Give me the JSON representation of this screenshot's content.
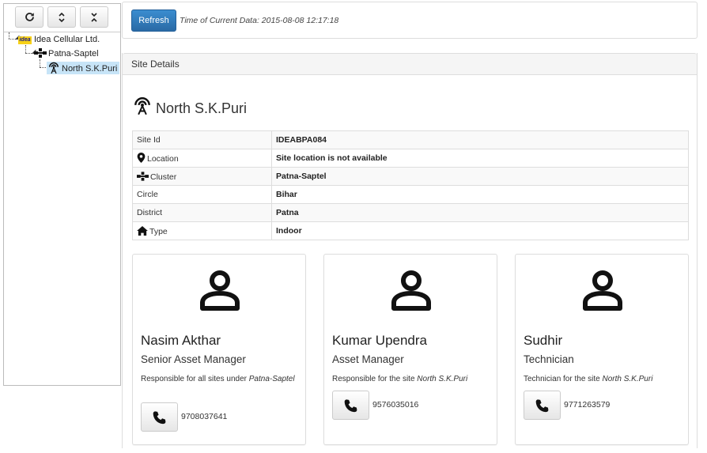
{
  "tree": {
    "toolbar": {
      "refresh_icon": "refresh-icon",
      "expand_icon": "expand-all-icon",
      "collapse_icon": "collapse-all-icon"
    },
    "nodes": [
      {
        "label": "Idea Cellular Ltd.",
        "icon": "idea-logo",
        "logo_text": "idea"
      },
      {
        "label": "Patna-Saptel",
        "icon": "cluster-icon"
      },
      {
        "label": "North S.K.Puri",
        "icon": "tower-icon",
        "selected": true
      }
    ]
  },
  "header": {
    "refresh_label": "Refresh",
    "data_time": "Time of Current Data: 2015-08-08 12:17:18"
  },
  "site": {
    "panel_title": "Site Details",
    "name": "North S.K.Puri",
    "details": [
      {
        "key": "Site Id",
        "value": "IDEABPA084",
        "icon": ""
      },
      {
        "key": "Location",
        "value": "Site location is not available",
        "icon": "map-marker-icon"
      },
      {
        "key": "Cluster",
        "value": "Patna-Saptel",
        "icon": "cluster-icon"
      },
      {
        "key": "Circle",
        "value": "Bihar",
        "icon": ""
      },
      {
        "key": "District",
        "value": "Patna",
        "icon": ""
      },
      {
        "key": "Type",
        "value": "Indoor",
        "icon": "home-icon"
      }
    ]
  },
  "contacts": [
    {
      "name": "Nasim Akthar",
      "role": "Senior Asset Manager",
      "desc_prefix": "Responsible for all sites under ",
      "desc_target": "Patna-Saptel",
      "phone": "9708037641"
    },
    {
      "name": "Kumar Upendra",
      "role": "Asset Manager",
      "desc_prefix": "Responsible for the site ",
      "desc_target": "North S.K.Puri",
      "phone": "9576035016"
    },
    {
      "name": "Sudhir",
      "role": "Technician",
      "desc_prefix": "Technician for the site ",
      "desc_target": "North S.K.Puri",
      "phone": "9771263579"
    }
  ],
  "colors": {
    "primary_button": "#2f78bb",
    "selected_node": "#c7e4f7",
    "logo_yellow": "#f7d117"
  }
}
